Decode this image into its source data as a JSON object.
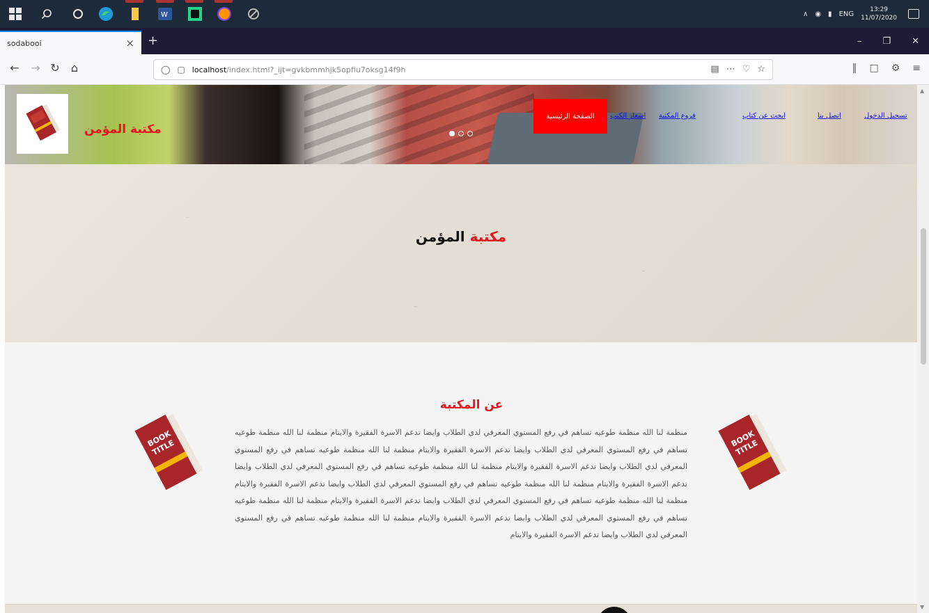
{
  "taskbar": {
    "clock_time": "13:29",
    "clock_date": "11/07/2020",
    "lang": "ENG"
  },
  "browser": {
    "tab_title": "sodabooi",
    "url_host": "localhost",
    "url_path": "/index.html?_ijt=gvkbmmhjk5opfiu7oksg14f9h",
    "colors": {
      "accent": "#0a84ff",
      "tabbar": "#1f1b36"
    }
  },
  "site": {
    "brand": "مكتبة المؤمن",
    "nav": {
      "home": "الصفحة الرئيسية",
      "rates": "اسعار الكتب",
      "library_branch": "فروع المكتبة",
      "search_book": "ابحث عن كتاب",
      "contact": "اتصل بنا",
      "login": "تسجيل الدخول"
    },
    "band_title_red": "مكتبة",
    "band_title_black": "المؤمن",
    "about_title": "عن المكتبة",
    "about_text": "منظمة لنا الله منظمة طوعيه تساهم في رفع المستوي المعرفي لدي الطلاب وايضا تدعم الاسرة الفقيرة والايتام منظمة لنا الله منظمة طوعيه تساهم في رفع المستوي المعرفي لدي الطلاب وايضا تدعم الاسرة الفقيرة والايتام منظمة لنا الله منظمة طوعيه تساهم في رفع المستوي المعرفي لدي الطلاب وايضا تدعم الاسرة الفقيرة والايتام منظمة لنا الله منظمة طوعيه تساهم في رفع المستوي المعرفي لدي الطلاب وايضا تدعم الاسرة الفقيرة والايتام منظمة لنا الله منظمة طوعيه تساهم في رفع المستوي المعرفي لدي الطلاب وايضا تدعم الاسرة الفقيرة والايتام منظمة لنا الله منظمة طوعيه تساهم في رفع المستوي المعرفي لدي الطلاب وايضا تدعم الاسرة الفقيرة والايتام منظمة لنا الله منظمة طوعيه تساهم في رفع المستوي المعرفي لدي الطلاب وايضا تدعم الاسرة الفقيرة والايتام منظمة لنا الله منظمة طوعيه تساهم في رفع المستوي المعرفي لدي الطلاب وايضا تدعم الاسرة الفقيرة والايتام",
    "book_cover_line1": "BOOK",
    "book_cover_line2": "TITLE",
    "colors": {
      "brand_red": "#e4161f",
      "nav_home_bg": "#ff0000",
      "nav_link": "#1010e8"
    }
  }
}
